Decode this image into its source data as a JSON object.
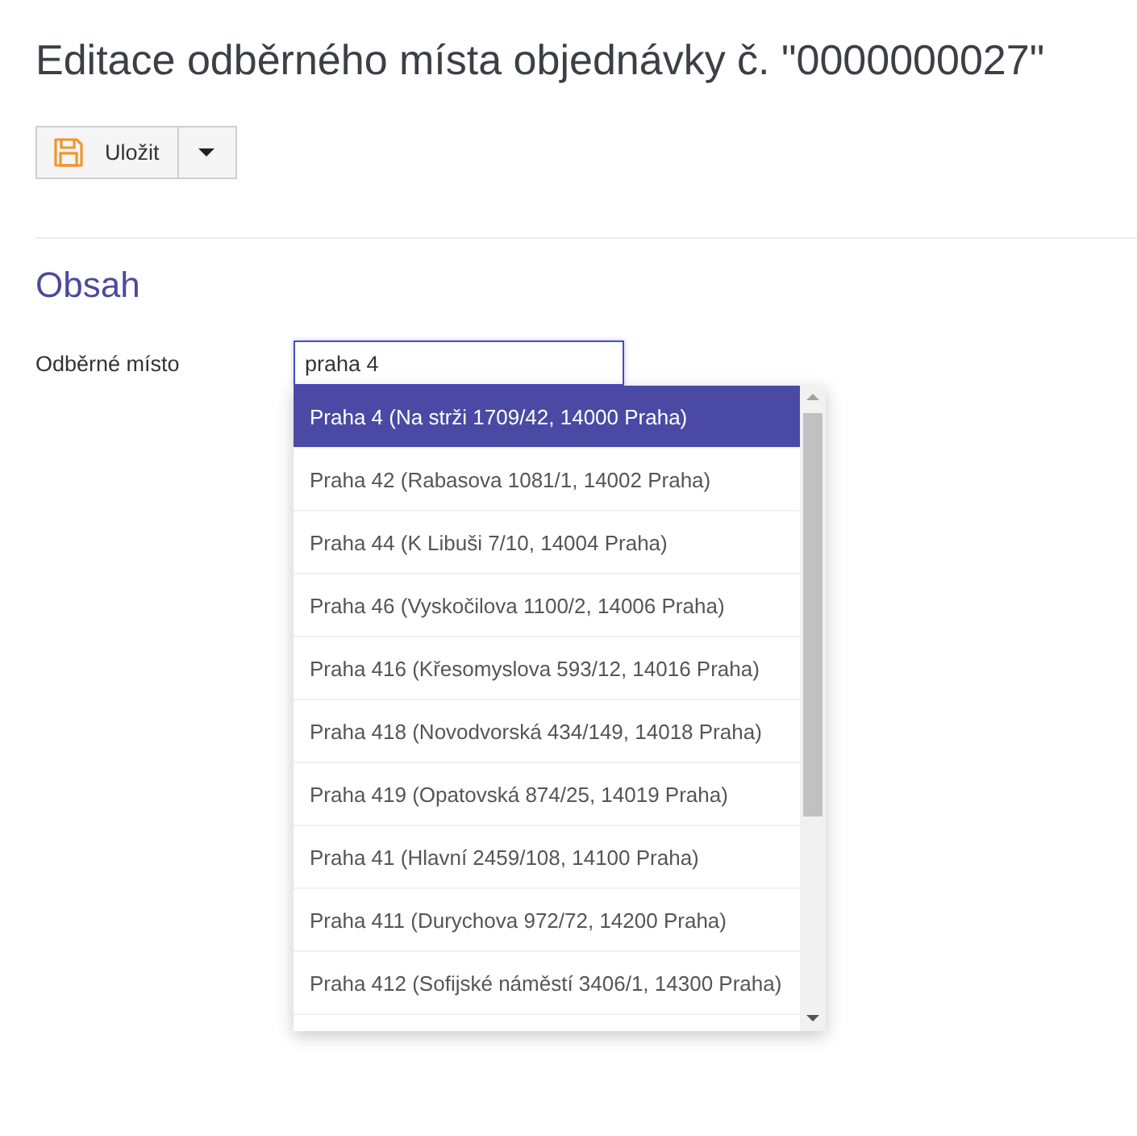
{
  "page": {
    "title": "Editace odběrného místa objednávky č. \"0000000027\""
  },
  "toolbar": {
    "save_button": {
      "label": "Uložit"
    }
  },
  "section": {
    "heading": "Obsah"
  },
  "form": {
    "fields": [
      {
        "label": "Odběrné místo",
        "value": "praha 4"
      }
    ]
  },
  "autocomplete": {
    "options": [
      {
        "label": "Praha 4 (Na strži 1709/42, 14000 Praha)",
        "selected": true
      },
      {
        "label": "Praha 42 (Rabasova 1081/1, 14002 Praha)",
        "selected": false
      },
      {
        "label": "Praha 44 (K Libuši 7/10, 14004 Praha)",
        "selected": false
      },
      {
        "label": "Praha 46 (Vyskočilova 1100/2, 14006 Praha)",
        "selected": false
      },
      {
        "label": "Praha 416 (Křesomyslova 593/12, 14016 Praha)",
        "selected": false
      },
      {
        "label": "Praha 418 (Novodvorská 434/149, 14018 Praha)",
        "selected": false
      },
      {
        "label": "Praha 419 (Opatovská 874/25, 14019 Praha)",
        "selected": false
      },
      {
        "label": "Praha 41 (Hlavní 2459/108, 14100 Praha)",
        "selected": false
      },
      {
        "label": "Praha 411 (Durychova 972/72, 14200 Praha)",
        "selected": false
      },
      {
        "label": "Praha 412 (Sofijské náměstí 3406/1, 14300 Praha)",
        "selected": false
      }
    ]
  }
}
